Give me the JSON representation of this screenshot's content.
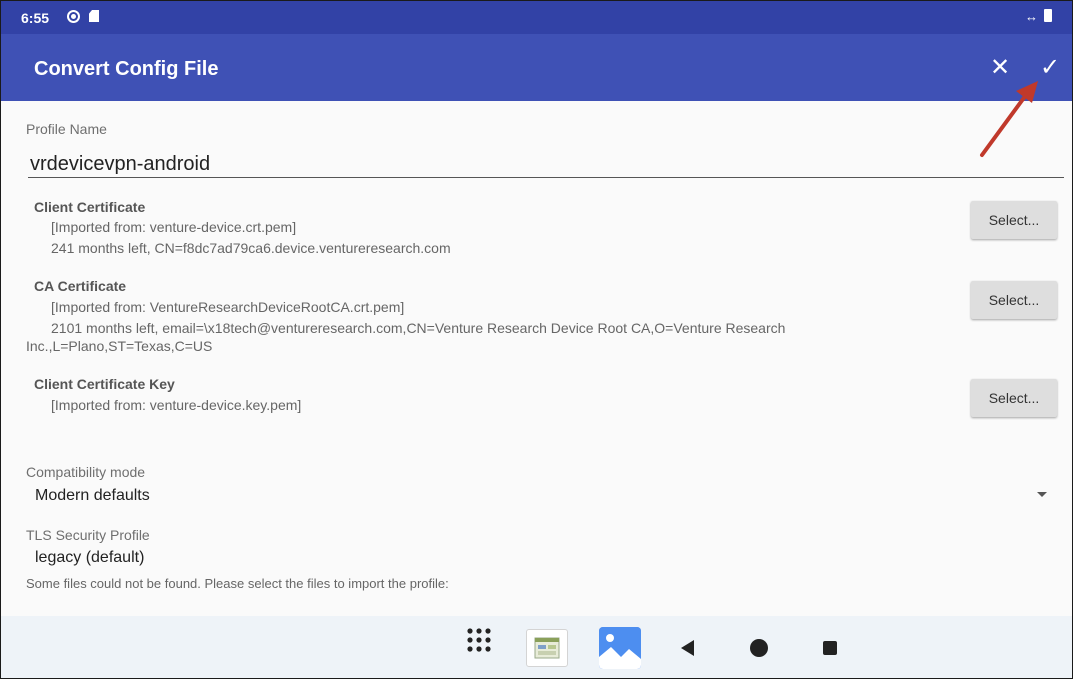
{
  "status_bar": {
    "time": "6:55"
  },
  "app_bar": {
    "title": "Convert Config File"
  },
  "profile": {
    "label": "Profile Name",
    "value": "vrdevicevpn-android"
  },
  "client_certificate": {
    "title": "Client Certificate",
    "imported": "[Imported from: venture-device.crt.pem]",
    "detail": "241 months left, CN=f8dc7ad79ca6.device.ventureresearch.com",
    "button": "Select..."
  },
  "ca_certificate": {
    "title": "CA Certificate",
    "imported": "[Imported from: VentureResearchDeviceRootCA.crt.pem]",
    "detail_line1": "2101 months left, email=\\x18tech@ventureresearch.com,CN=Venture Research Device Root CA,O=Venture Research",
    "detail_line2": "Inc.,L=Plano,ST=Texas,C=US",
    "button": "Select..."
  },
  "client_key": {
    "title": "Client Certificate Key",
    "imported": "[Imported from: venture-device.key.pem]",
    "button": "Select..."
  },
  "compatibility": {
    "label": "Compatibility mode",
    "value": "Modern defaults"
  },
  "tls": {
    "label": "TLS Security Profile",
    "value": "legacy (default)"
  },
  "message": "Some files could not be found. Please select the files to import the profile:",
  "colors": {
    "status_bar": "#3242a6",
    "app_bar": "#3f51b5",
    "fab": "#ffa726",
    "annotation_arrow": "#c0392b"
  },
  "icons": {
    "close": "close-icon",
    "check": "check-icon",
    "save": "save-icon",
    "apps": "app-drawer-icon",
    "back": "back-icon",
    "home": "home-icon",
    "recents": "recents-icon"
  }
}
